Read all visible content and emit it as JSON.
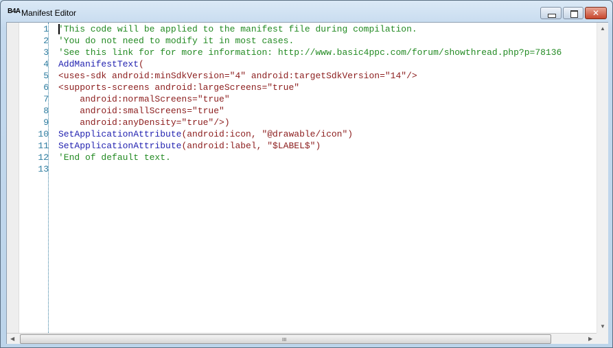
{
  "window": {
    "logo": "B4A",
    "title": "Manifest Editor",
    "close_glyph": "✕"
  },
  "editor": {
    "line_numbers": [
      "1",
      "2",
      "3",
      "4",
      "5",
      "6",
      "7",
      "8",
      "9",
      "10",
      "11",
      "12",
      "13"
    ],
    "lines": [
      [
        {
          "t": "'This code will be applied to the manifest file during compilation.",
          "c": "cm"
        }
      ],
      [
        {
          "t": "'You do not need to modify it in most cases.",
          "c": "cm"
        }
      ],
      [
        {
          "t": "'See this link for for more information: http://www.basic4ppc.com/forum/showthread.php?p=78136",
          "c": "cm"
        }
      ],
      [
        {
          "t": "AddManifestText",
          "c": "kw"
        },
        {
          "t": "(",
          "c": "st"
        }
      ],
      [
        {
          "t": "<uses-sdk android:minSdkVersion=\"4\" android:targetSdkVersion=\"14\"/>",
          "c": "st"
        }
      ],
      [
        {
          "t": "<supports-screens android:largeScreens=\"true\"",
          "c": "st"
        }
      ],
      [
        {
          "t": "    android:normalScreens=\"true\"",
          "c": "st"
        }
      ],
      [
        {
          "t": "    android:smallScreens=\"true\"",
          "c": "st"
        }
      ],
      [
        {
          "t": "    android:anyDensity=\"true\"/>)",
          "c": "st"
        }
      ],
      [
        {
          "t": "SetApplicationAttribute",
          "c": "kw"
        },
        {
          "t": "(android:icon, \"@drawable/icon\")",
          "c": "st"
        }
      ],
      [
        {
          "t": "SetApplicationAttribute",
          "c": "kw"
        },
        {
          "t": "(android:label, \"$LABEL$\")",
          "c": "st"
        }
      ],
      [
        {
          "t": "'End of default text.",
          "c": "cm"
        }
      ],
      []
    ]
  },
  "scrollbar": {
    "grip": "III",
    "up": "▲",
    "down": "▼",
    "left": "◀",
    "right": "▶"
  }
}
